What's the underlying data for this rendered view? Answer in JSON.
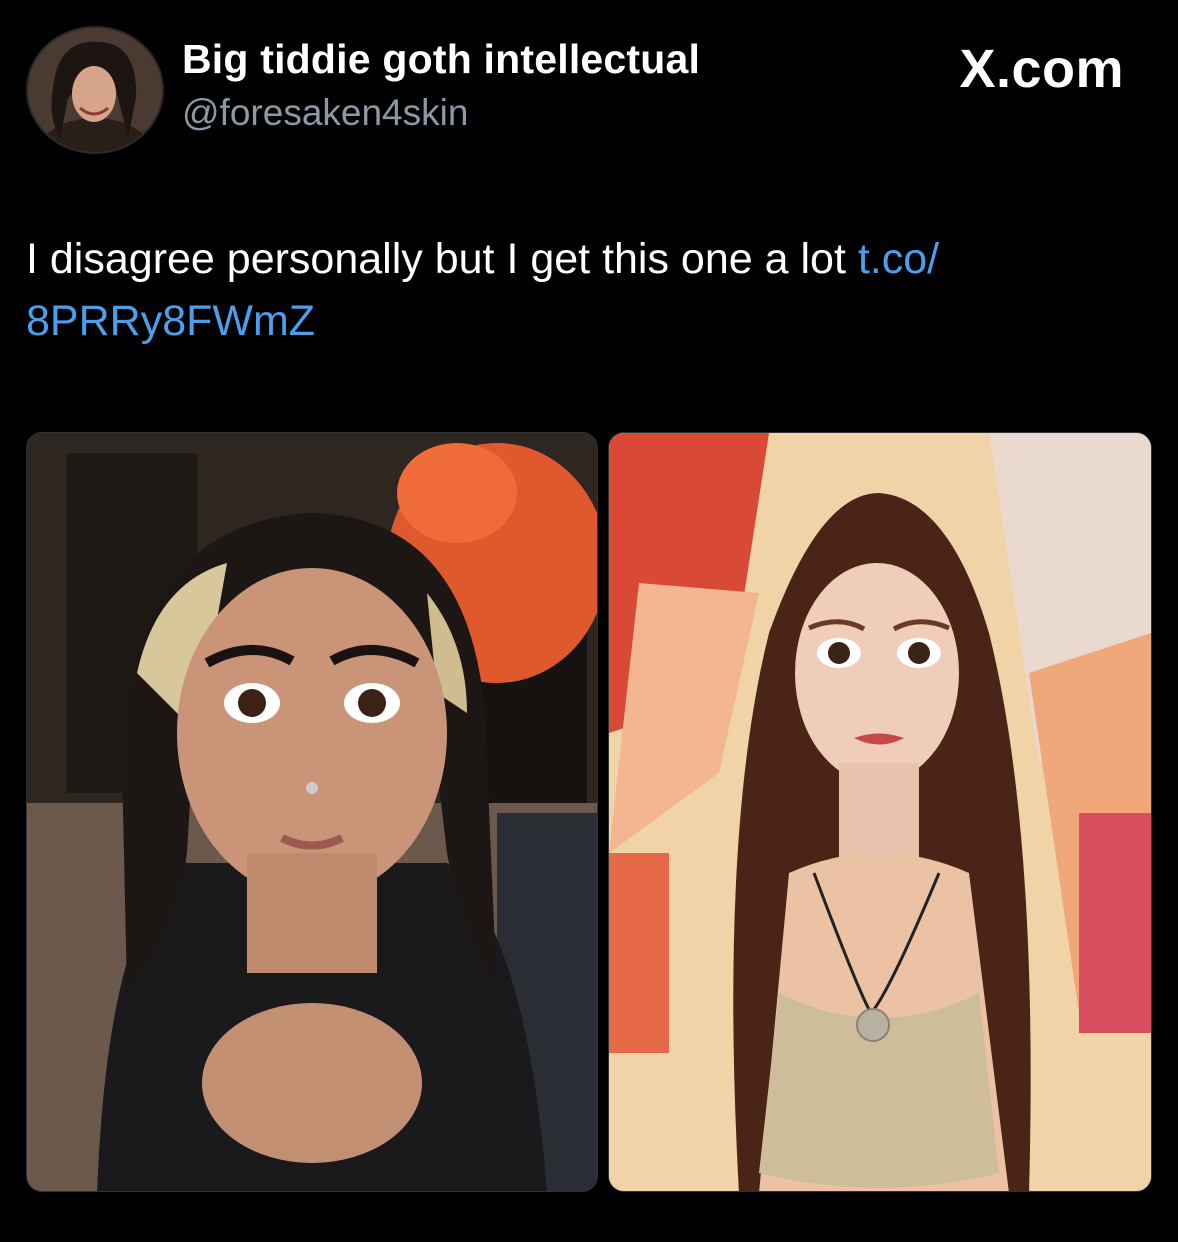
{
  "tweet": {
    "author": {
      "display_name": "Big tiddie goth intellectual",
      "handle": "@foresaken4skin",
      "avatar_icon": "profile-photo"
    },
    "brand": "X.com",
    "text": "I disagree personally but I get this one a lot ",
    "link": "t.co/\n8PRRy8FWmZ",
    "media": [
      {
        "kind": "photo",
        "icon": "selfie-photo"
      },
      {
        "kind": "photo",
        "icon": "portrait-photo"
      }
    ]
  },
  "colors": {
    "background": "#000000",
    "text": "#ffffff",
    "secondary": "#8b98a5",
    "link": "#4c9eeb"
  }
}
